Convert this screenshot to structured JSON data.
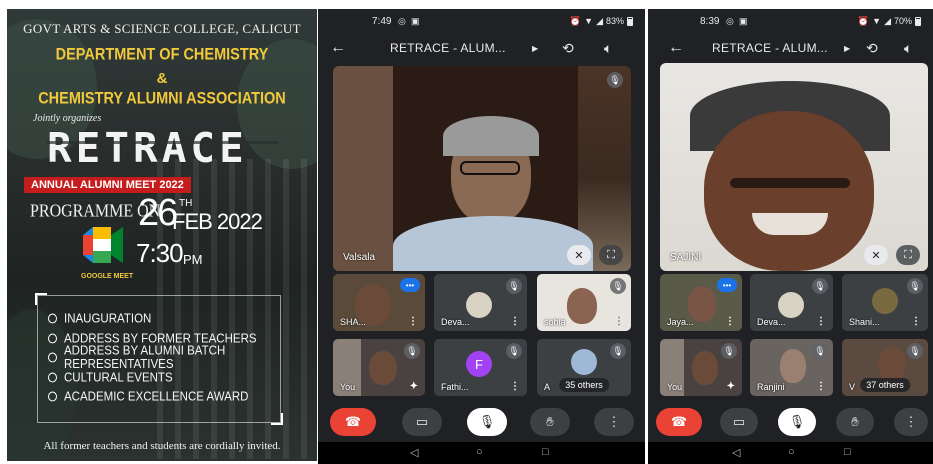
{
  "poster": {
    "college": "GOVT ARTS & SCIENCE COLLEGE, CALICUT",
    "department": "DEPARTMENT OF CHEMISTRY",
    "ampersand": "&",
    "association": "CHEMISTRY ALUMNI ASSOCIATION",
    "jointly": "Jointly organizes",
    "event_name": "RETRACE",
    "event_sub": "ANNUAL ALUMNI MEET 2022",
    "programme_on": "PROGRAMME ON",
    "date_day": "26",
    "date_suffix": "TH",
    "date_month_year": "FEB 2022",
    "time": "7:30",
    "time_suffix": "PM",
    "platform_label": "GOOGLE MEET",
    "agenda": [
      "INAUGURATION",
      "ADDRESS BY FORMER TEACHERS",
      "ADDRESS BY ALUMNI BATCH REPRESENTATIVES",
      "CULTURAL EVENTS",
      "ACADEMIC EXCELLENCE AWARD"
    ],
    "footer": "All former teachers and students are cordially invited.",
    "colors": {
      "gold": "#f2c93b",
      "red_banner": "#c51d1d"
    }
  },
  "phones": [
    {
      "status_time": "7:49",
      "battery": "83%",
      "meeting_title": "RETRACE - ALUM...",
      "main_participant": "Valsala",
      "tiles": [
        {
          "name": "SHA...",
          "state": "speaking"
        },
        {
          "name": "Deva...",
          "state": "muted"
        },
        {
          "name": "sobia",
          "state": "muted"
        },
        {
          "name": "You",
          "state": "muted"
        },
        {
          "name": "Fathi...",
          "state": "muted",
          "initial": "F"
        },
        {
          "name": "A",
          "state": "muted"
        }
      ],
      "others": "35 others"
    },
    {
      "status_time": "8:39",
      "battery": "70%",
      "meeting_title": "RETRACE - ALUM...",
      "main_participant": "SAJINI",
      "tiles": [
        {
          "name": "Jaya...",
          "state": "speaking"
        },
        {
          "name": "Deva...",
          "state": "muted"
        },
        {
          "name": "Shani...",
          "state": "muted"
        },
        {
          "name": "You",
          "state": "muted"
        },
        {
          "name": "Ranjini",
          "state": "muted"
        },
        {
          "name": "V",
          "state": "muted"
        }
      ],
      "others": "37 others"
    }
  ],
  "icons": {
    "back": "arrow-left-icon",
    "caret": "caret-right-icon",
    "camera_flip": "camera-flip-icon",
    "speaker": "speaker-icon",
    "end_call": "end-call-icon",
    "video": "video-camera-icon",
    "mic_off": "mic-off-icon",
    "raise_hand": "raise-hand-icon",
    "more": "more-vert-icon"
  },
  "colors": {
    "meet_bg": "#202124",
    "tile_bg": "#3c4043",
    "end_call_red": "#ea4335",
    "speaking_blue": "#1a73e8"
  }
}
